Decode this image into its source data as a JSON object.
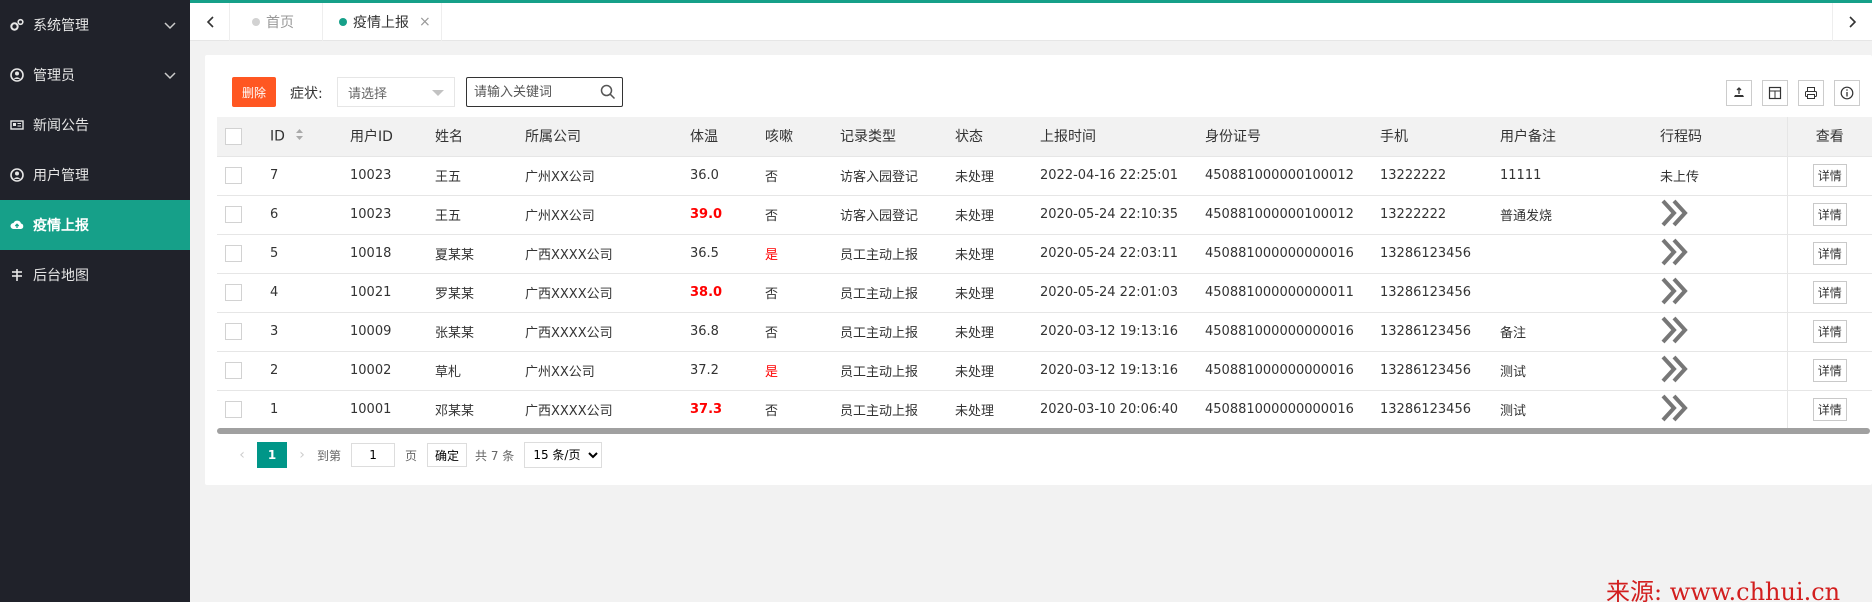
{
  "sidebar": {
    "items": [
      {
        "label": "系统管理",
        "icon": "gears-icon",
        "has_chevron": true
      },
      {
        "label": "管理员",
        "icon": "user-circle-icon",
        "has_chevron": true
      },
      {
        "label": "新闻公告",
        "icon": "newspaper-icon",
        "has_chevron": false
      },
      {
        "label": "用户管理",
        "icon": "user-circle-icon",
        "has_chevron": false
      },
      {
        "label": "疫情上报",
        "icon": "cloud-upload-icon",
        "has_chevron": false,
        "active": true
      },
      {
        "label": "后台地图",
        "icon": "map-icon",
        "has_chevron": false
      }
    ]
  },
  "tabs": {
    "home": "首页",
    "active": "疫情上报",
    "close_glyph": "×"
  },
  "toolbar": {
    "delete_label": "删除",
    "symptom_label": "症状:",
    "symptom_select": "请选择",
    "search_placeholder": "请输入关键词",
    "icons": [
      "export-icon",
      "columns-icon",
      "print-icon",
      "info-icon"
    ]
  },
  "table": {
    "headers": [
      "ID",
      "用户ID",
      "姓名",
      "所属公司",
      "体温",
      "咳嗽",
      "记录类型",
      "状态",
      "上报时间",
      "身份证号",
      "手机",
      "用户备注",
      "行程码",
      "查看"
    ],
    "rows": [
      {
        "id": "7",
        "uid": "10023",
        "name": "王五",
        "company": "广州XX公司",
        "temp": "36.0",
        "hot": false,
        "cough": "否",
        "type": "访客入园登记",
        "status": "未处理",
        "time": "2022-04-16 22:25:01",
        "idcard": "450881000000100012",
        "phone": "13222222",
        "note": "11111",
        "trip": "未上传",
        "detail": "详情"
      },
      {
        "id": "6",
        "uid": "10023",
        "name": "王五",
        "company": "广州XX公司",
        "temp": "39.0",
        "hot": true,
        "cough": "否",
        "type": "访客入园登记",
        "status": "未处理",
        "time": "2020-05-24 22:10:35",
        "idcard": "450881000000100012",
        "phone": "13222222",
        "note": "普通发烧",
        "trip": "",
        "detail": "详情"
      },
      {
        "id": "5",
        "uid": "10018",
        "name": "夏某某",
        "company": "广西XXXX公司",
        "temp": "36.5",
        "hot": false,
        "cough": "是",
        "type": "员工主动上报",
        "status": "未处理",
        "time": "2020-05-24 22:03:11",
        "idcard": "450881000000000016",
        "phone": "13286123456",
        "note": "",
        "trip": "",
        "detail": "详情"
      },
      {
        "id": "4",
        "uid": "10021",
        "name": "罗某某",
        "company": "广西XXXX公司",
        "temp": "38.0",
        "hot": true,
        "cough": "否",
        "type": "员工主动上报",
        "status": "未处理",
        "time": "2020-05-24 22:01:03",
        "idcard": "450881000000000011",
        "phone": "13286123456",
        "note": "",
        "trip": "",
        "detail": "详情"
      },
      {
        "id": "3",
        "uid": "10009",
        "name": "张某某",
        "company": "广西XXXX公司",
        "temp": "36.8",
        "hot": false,
        "cough": "否",
        "type": "员工主动上报",
        "status": "未处理",
        "time": "2020-03-12 19:13:16",
        "idcard": "450881000000000016",
        "phone": "13286123456",
        "note": "备注",
        "trip": "",
        "detail": "详情"
      },
      {
        "id": "2",
        "uid": "10002",
        "name": "草札",
        "company": "广州XX公司",
        "temp": "37.2",
        "hot": false,
        "cough": "是",
        "type": "员工主动上报",
        "status": "未处理",
        "time": "2020-03-12 19:13:16",
        "idcard": "450881000000000016",
        "phone": "13286123456",
        "note": "测试",
        "trip": "",
        "detail": "详情"
      },
      {
        "id": "1",
        "uid": "10001",
        "name": "邓某某",
        "company": "广西XXXX公司",
        "temp": "37.3",
        "hot": true,
        "cough": "否",
        "type": "员工主动上报",
        "status": "未处理",
        "time": "2020-03-10 20:06:40",
        "idcard": "450881000000000016",
        "phone": "13286123456",
        "note": "测试",
        "trip": "",
        "detail": "详情"
      }
    ]
  },
  "pagination": {
    "current": "1",
    "goto_label": "到第",
    "goto_value": "1",
    "page_unit": "页",
    "confirm": "确定",
    "total": "共 7 条",
    "page_size": "15 条/页"
  },
  "watermark": "来源: www.chhui.cn",
  "colors": {
    "sidebar_bg": "#20222a",
    "accent": "#16a089",
    "delete": "#ff5722",
    "alert": "#ff0000"
  }
}
